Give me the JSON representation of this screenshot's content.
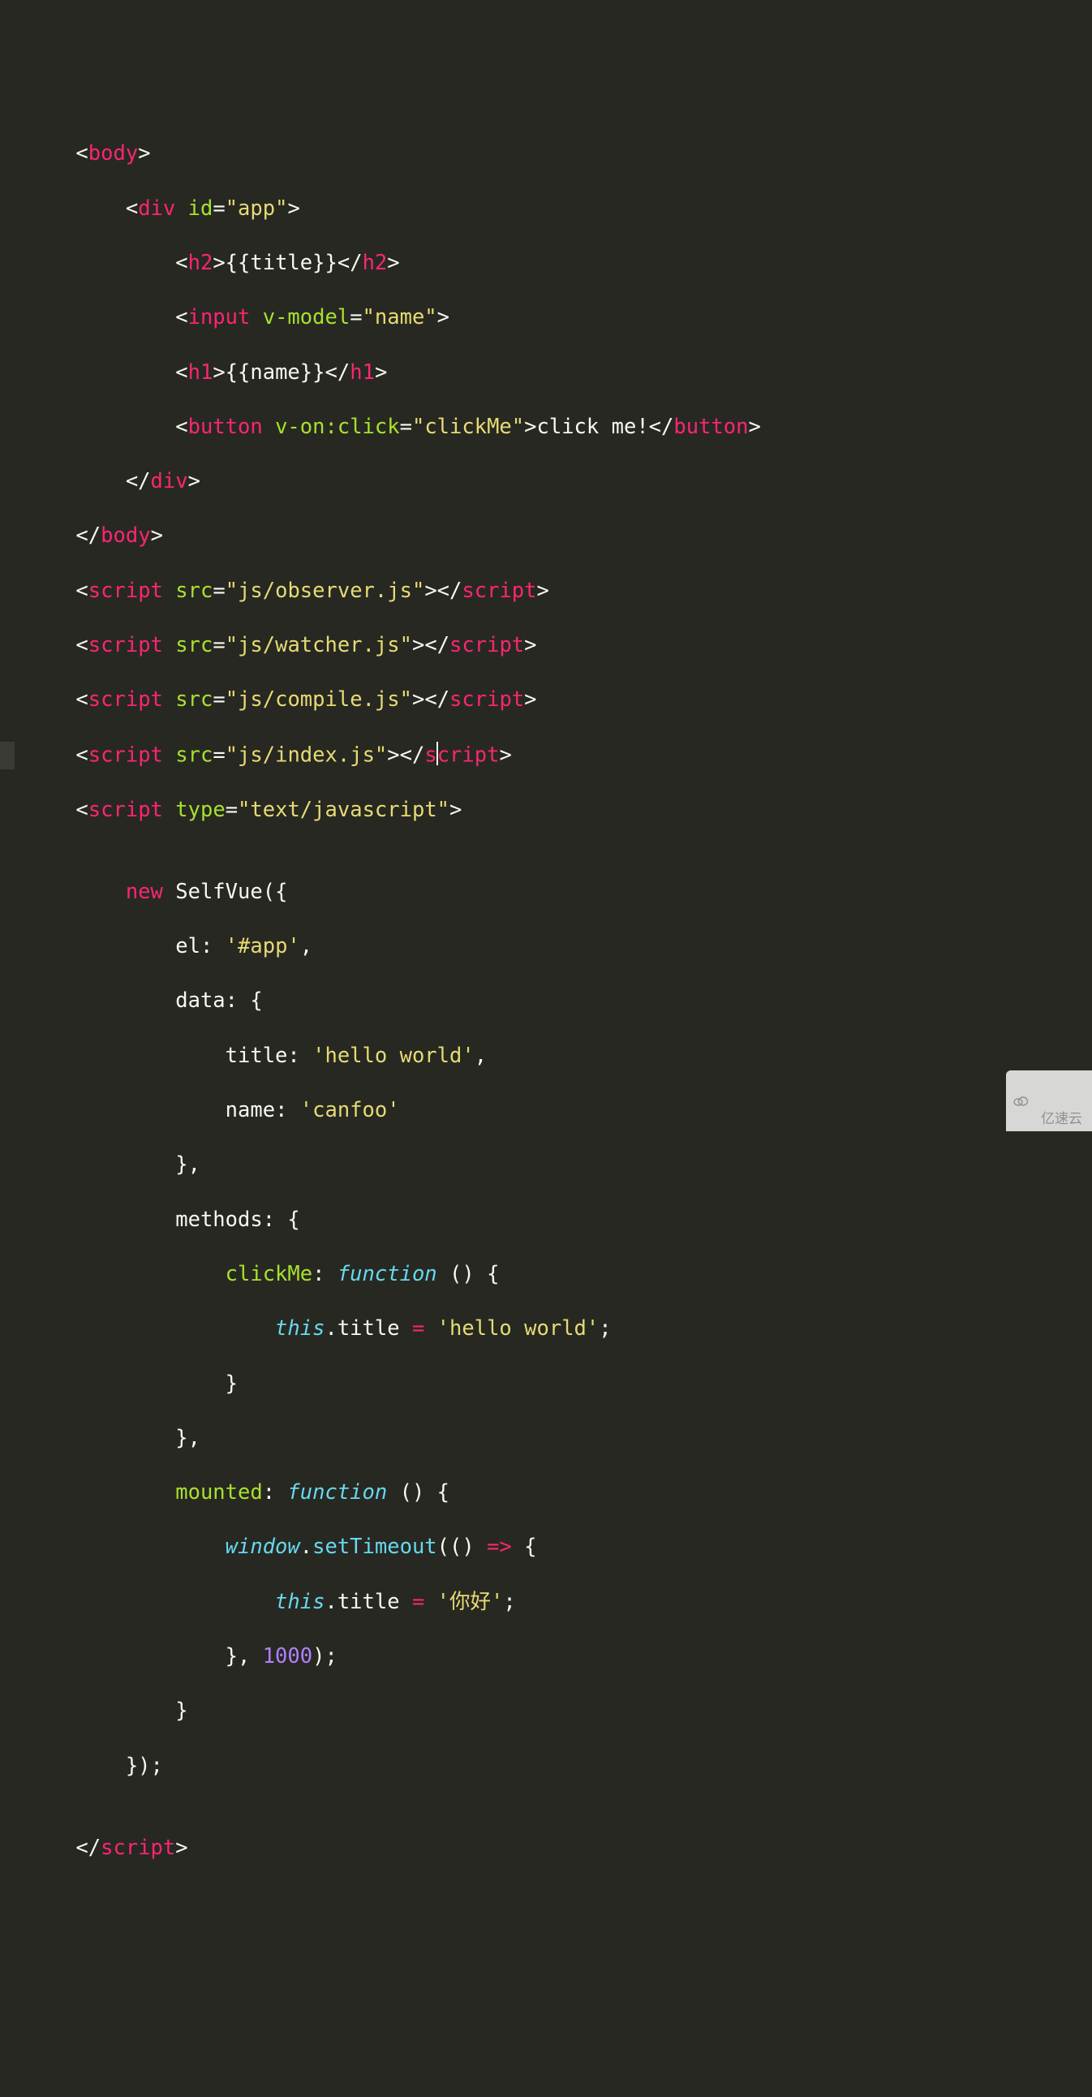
{
  "code": {
    "tag_body": "body",
    "tag_div": "div",
    "attr_id": "id",
    "val_app": "\"app\"",
    "tag_h2": "h2",
    "text_title_interp": "{{title}}",
    "tag_input": "input",
    "attr_vmodel": "v-model",
    "val_name": "\"name\"",
    "tag_h1": "h1",
    "text_name_interp": "{{name}}",
    "tag_button": "button",
    "attr_vonclick": "v-on:click",
    "val_clickMe": "\"clickMe\"",
    "text_clickme": "click me!",
    "tag_script": "script",
    "attr_src": "src",
    "val_observer": "\"js/observer.js\"",
    "val_watcher": "\"js/watcher.js\"",
    "val_compile": "\"js/compile.js\"",
    "val_index": "\"js/index.js\"",
    "attr_type": "type",
    "val_textjs": "\"text/javascript\"",
    "kw_new": "new",
    "cls_SelfVue": "SelfVue",
    "key_el": "el",
    "str_elval": "'#app'",
    "key_data": "data",
    "key_title": "title",
    "str_helloworld": "'hello world'",
    "key_name": "name",
    "str_canfoo": "'canfoo'",
    "key_methods": "methods",
    "key_clickMe": "clickMe",
    "kw_function": "function",
    "kw_this": "this",
    "prop_title": "title",
    "str_helloworld2": "'hello world'",
    "key_mounted": "mounted",
    "obj_window": "window",
    "fn_setTimeout": "setTimeout",
    "arrow": "=>",
    "str_nihao": "'你好'",
    "num_1000": "1000"
  },
  "watermark": "亿速云"
}
